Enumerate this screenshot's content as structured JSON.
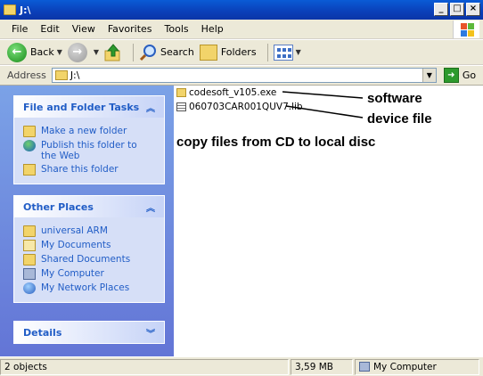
{
  "window": {
    "title": "J:\\"
  },
  "menu": [
    "File",
    "Edit",
    "View",
    "Favorites",
    "Tools",
    "Help"
  ],
  "toolbar": {
    "back": "Back",
    "search": "Search",
    "folders": "Folders"
  },
  "address": {
    "label": "Address",
    "value": "J:\\",
    "go": "Go"
  },
  "tasks": {
    "title": "File and Folder Tasks",
    "items": [
      "Make a new folder",
      "Publish this folder to the Web",
      "Share this folder"
    ]
  },
  "other_places": {
    "title": "Other Places",
    "items": [
      "universal ARM",
      "My Documents",
      "Shared Documents",
      "My Computer",
      "My Network Places"
    ]
  },
  "details": {
    "title": "Details"
  },
  "files": [
    {
      "name": "codesoft_v105.exe",
      "icon": "exe-icon"
    },
    {
      "name": "060703CAR001QUV7.lib",
      "icon": "lib-file-icon"
    }
  ],
  "annotations": {
    "software": "software",
    "device_file": "device file",
    "instruction": "copy files from CD to local disc"
  },
  "status": {
    "objects": "2 objects",
    "size": "3,59 MB",
    "location": "My Computer"
  }
}
